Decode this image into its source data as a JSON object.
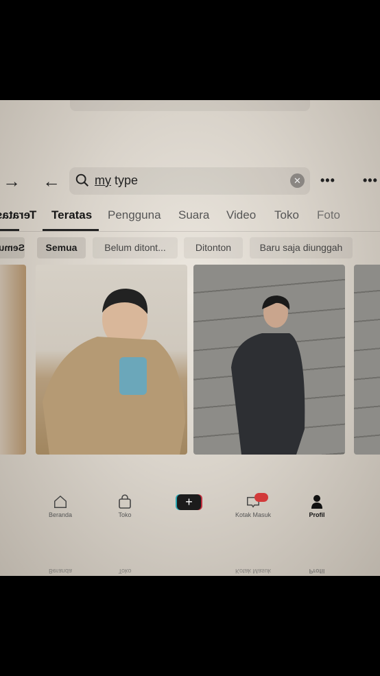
{
  "search": {
    "query_underlined": "my",
    "query_rest": " type",
    "clear_icon": "close-icon",
    "search_icon": "search-icon"
  },
  "header": {
    "back_icon": "arrow-left-icon",
    "forward_icon": "arrow-right-icon",
    "more_icon": "more-dots-icon",
    "more_label": "•••"
  },
  "tabs": [
    {
      "label": "Teratas",
      "active": true
    },
    {
      "label": "Pengguna"
    },
    {
      "label": "Suara"
    },
    {
      "label": "Video"
    },
    {
      "label": "Toko"
    },
    {
      "label": "Foto"
    }
  ],
  "filters": [
    {
      "label": "Semua",
      "active": true
    },
    {
      "label": "Belum ditont..."
    },
    {
      "label": "Ditonton"
    },
    {
      "label": "Baru saja diunggah"
    }
  ],
  "bottom_nav": [
    {
      "label": "Beranda",
      "icon": "home-icon"
    },
    {
      "label": "Toko",
      "icon": "shop-bag-icon"
    },
    {
      "label": "",
      "icon": "plus-icon"
    },
    {
      "label": "Kotak Masuk",
      "icon": "inbox-icon",
      "badge": true
    },
    {
      "label": "Profil",
      "icon": "profile-icon",
      "active": true
    }
  ],
  "colors": {
    "badge": "#d23a3a",
    "accent_cyan": "#2aa9b5",
    "accent_red": "#c4303f"
  }
}
